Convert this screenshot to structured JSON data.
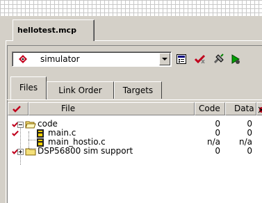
{
  "project_tab": {
    "title": "hellotest.mcp"
  },
  "target_selector": {
    "selected": "simulator"
  },
  "toolbar": {
    "icons": [
      "target-settings-icon",
      "synchronize-icon",
      "make-icon",
      "debug-icon"
    ]
  },
  "tabs": [
    {
      "label": "Files",
      "active": true
    },
    {
      "label": "Link Order",
      "active": false
    },
    {
      "label": "Targets",
      "active": false
    }
  ],
  "columns": {
    "file": "File",
    "code": "Code",
    "data": "Data"
  },
  "files": [
    {
      "name": "code",
      "code": "0",
      "data": "0",
      "type": "folder",
      "expanded": true,
      "checked": true
    },
    {
      "name": "main.c",
      "code": "0",
      "data": "0",
      "type": "file",
      "checked": true
    },
    {
      "name": "main_hostio.c",
      "code": "n/a",
      "data": "n/a",
      "type": "file",
      "checked": false
    },
    {
      "name": "DSP56800 sim support",
      "code": "0",
      "data": "0",
      "type": "folder",
      "expanded": false,
      "checked": true
    }
  ],
  "colors": {
    "check": "#c0001c",
    "folder": "#f4e07a",
    "face": "#d4d0c8"
  }
}
